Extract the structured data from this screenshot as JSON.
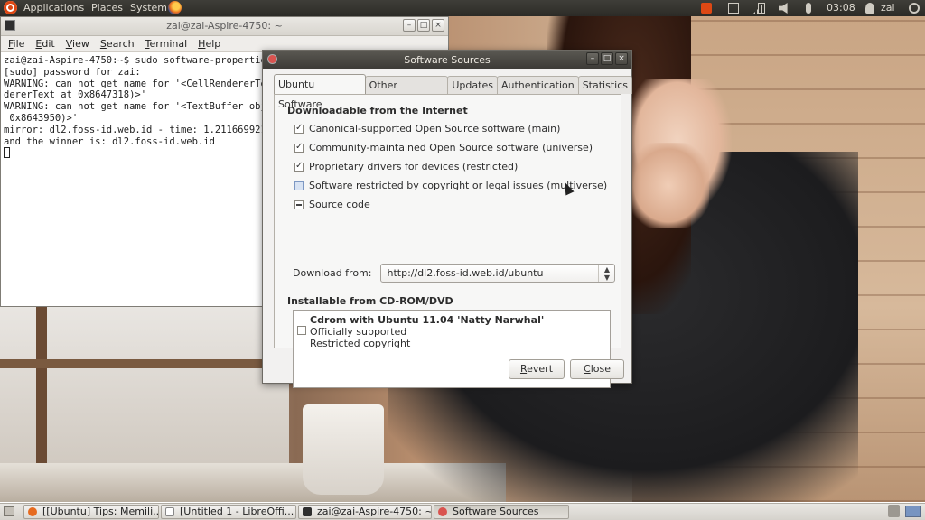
{
  "top_panel": {
    "menus": [
      "Applications",
      "Places",
      "System"
    ],
    "clock": "03:08",
    "user": "zai",
    "tray_icons": [
      "ubuntu-one-icon",
      "mail-icon",
      "network-signal-icon",
      "battery-icon",
      "volume-icon",
      "mic-icon",
      "user-icon",
      "power-icon"
    ]
  },
  "terminal": {
    "title": "zai@zai-Aspire-4750: ~",
    "menu": [
      "File",
      "Edit",
      "View",
      "Search",
      "Terminal",
      "Help"
    ],
    "lines": [
      "zai@zai-Aspire-4750:~$ sudo software-properties-",
      "[sudo] password for zai:",
      "WARNING: can not get name for '<CellRendererText",
      "dererText at 0x8647318)>'",
      "WARNING: can not get name for '<TextBuffer objec",
      " 0x8643950)>'",
      "mirror: dl2.foss-id.web.id - time: 1.21166992188",
      "and the winner is: dl2.foss-id.web.id"
    ]
  },
  "dialog": {
    "title": "Software Sources",
    "tabs": [
      "Ubuntu Software",
      "Other Software",
      "Updates",
      "Authentication",
      "Statistics"
    ],
    "downloadable_title": "Downloadable from the Internet",
    "options": [
      {
        "label": "Canonical-supported Open Source software (main)",
        "state": "checked"
      },
      {
        "label": "Community-maintained Open Source software (universe)",
        "state": "checked"
      },
      {
        "label": "Proprietary drivers for devices (restricted)",
        "state": "checked"
      },
      {
        "label": "Software restricted by copyright or legal issues (multiverse)",
        "state": "unchecked"
      },
      {
        "label": "Source code",
        "state": "mixed"
      }
    ],
    "download_from_label": "Download from:",
    "download_from_value": "http://dl2.foss-id.web.id/ubuntu",
    "cdrom_title": "Installable from CD-ROM/DVD",
    "cdrom_entry": {
      "name": "Cdrom with Ubuntu 11.04 'Natty Narwhal'",
      "line1": "Officially supported",
      "line2": "Restricted copyright",
      "checked": false
    },
    "buttons": {
      "revert": "Revert",
      "close": "Close"
    }
  },
  "taskbar": {
    "tasks": [
      {
        "label": "[[Ubuntu] Tips: Memili...",
        "icon": "firefox-icon",
        "active": false
      },
      {
        "label": "[Untitled 1 - LibreOffi...",
        "icon": "document-icon",
        "active": false
      },
      {
        "label": "zai@zai-Aspire-4750: ~",
        "icon": "terminal-icon",
        "active": false
      },
      {
        "label": "Software Sources",
        "icon": "software-sources-icon",
        "active": true
      }
    ]
  },
  "colors": {
    "ubuntu_orange": "#dd4814",
    "panel_dark": "#3c3b37",
    "dialog_bg": "#f2f1f0"
  }
}
